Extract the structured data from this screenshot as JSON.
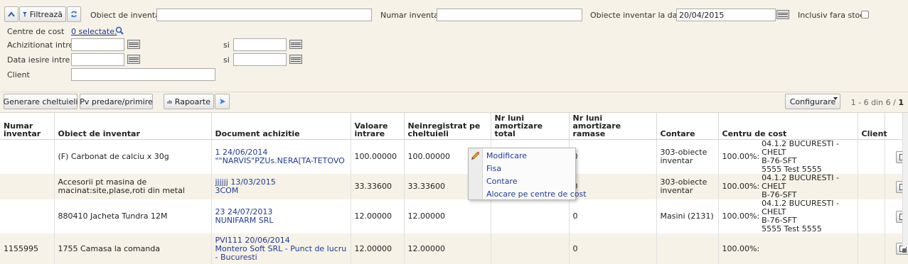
{
  "filters": {
    "filter_button": "Filtrează",
    "obiect_label": "Obiect de inventar",
    "obiect_value": "",
    "numar_label": "Numar inventar",
    "numar_value": "",
    "la_data_label": "Obiecte inventar la data",
    "la_data_value": "20/04/2015",
    "fara_stoc_label": "Inclusiv fara stoc",
    "centre_label": "Centre de cost",
    "centre_link": "0 selectate.",
    "achizitionat_label": "Achizitionat intre",
    "iesire_label": "Data iesire intre",
    "si_label": "si",
    "client_label": "Client"
  },
  "toolbar": {
    "generare": "Generare cheltuieli",
    "pv": "Pv predare/primire",
    "rapoarte": "Rapoarte",
    "configurare": "Configurare",
    "pager_text": "1 - 6 din 6 / ",
    "pager_page": "1"
  },
  "columns": {
    "numar": "Numar inventar",
    "obiect": "Obiect de inventar",
    "document": "Document achizitie",
    "valoare": "Valoare intrare",
    "neinregistrat": "Neinregistrat pe cheltuieli",
    "luni_total": "Nr luni amortizare total",
    "luni_ramase": "Nr luni amortizare ramase",
    "contare": "Contare",
    "centru": "Centru de cost",
    "client": "Client"
  },
  "rows": [
    {
      "numar": "",
      "obiect": "(F) Carbonat de calciu x 30g",
      "doc_num": "1 24/06/2014",
      "doc_supplier": "\"\"NARVIS\"PZUs.NERA[TA-TETOVO",
      "valoare": "100.00000",
      "neinregistrat": "100.00000",
      "luni_total": "",
      "luni_ramase": "0",
      "contare": "303-obiecte inventar",
      "centru_pct": "100.00%:",
      "centru_lines": [
        "04.1.2 BUCURESTI - CHELT",
        "B-76-SFT",
        "5555 Test 5555"
      ],
      "client": ""
    },
    {
      "numar": "",
      "obiect": "Accesorii pt masina de macinat:site,plase,roti din metal",
      "doc_num": "jjjjjj 13/03/2015",
      "doc_supplier": "3COM",
      "valoare": "33.33600",
      "neinregistrat": "33.33600",
      "luni_total": "",
      "luni_ramase": "0",
      "contare": "303-obiecte inventar",
      "centru_pct": "100.00%:",
      "centru_lines": [
        "04.1.2 BUCURESTI - CHELT",
        "B-76-SFT"
      ],
      "client": ""
    },
    {
      "numar": "",
      "obiect": "880410 Jacheta Tundra 12M",
      "doc_num": "23 24/07/2013",
      "doc_supplier": "NUNIFARM SRL",
      "valoare": "12.00000",
      "neinregistrat": "12.00000",
      "luni_total": "",
      "luni_ramase": "0",
      "contare": "Masini (2131)",
      "centru_pct": "100.00%:",
      "centru_lines": [
        "04.1.2 BUCURESTI - CHELT",
        "B-76-SFT",
        "5555 Test 5555"
      ],
      "client": ""
    },
    {
      "numar": "1155995",
      "obiect": "1755 Camasa la comanda",
      "doc_num": "PVI111 20/06/2014",
      "doc_supplier": "Montero Soft SRL - Punct de lucru - Bucuresti",
      "valoare": "12.00000",
      "neinregistrat": "12.00000",
      "luni_total": "",
      "luni_ramase": "0",
      "contare": "",
      "centru_pct": "100.00%:",
      "centru_lines": [],
      "client": ""
    }
  ],
  "context_menu": {
    "modificare": "Modificare",
    "fisa": "Fisa",
    "contare": "Contare",
    "alocare": "Alocare pe centre de cost"
  },
  "colors": {
    "accent": "#1f3a93",
    "panel": "#f7f2e7"
  }
}
